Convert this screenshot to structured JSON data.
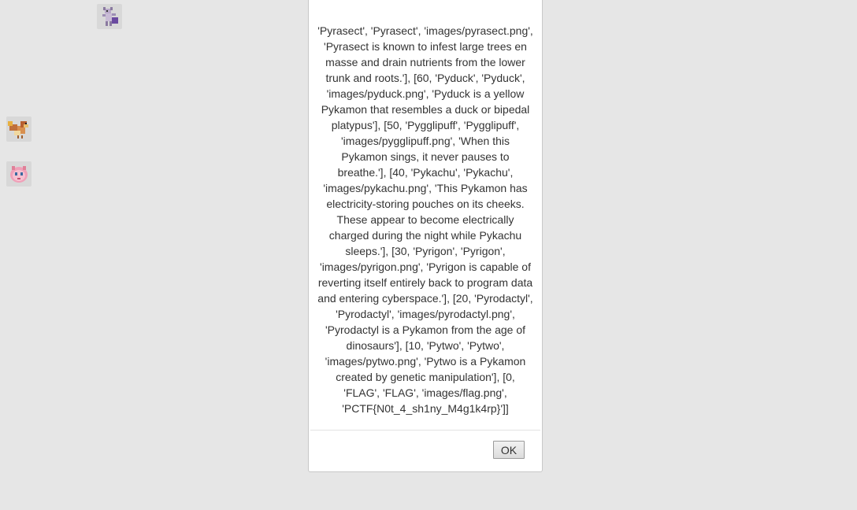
{
  "background": {
    "sprites": [
      {
        "name": "pytwo-sprite",
        "icon": "pytwo-icon"
      },
      {
        "name": "pidgeot-sprite",
        "icon": "bird-icon"
      },
      {
        "name": "jigglypuff-sprite",
        "icon": "pink-balloon-icon"
      }
    ]
  },
  "dialog": {
    "message": "'Pyrasect', 'Pyrasect', 'images/pyrasect.png', 'Pyrasect is known to infest large trees en masse and drain nutrients from the lower trunk and roots.'], [60, 'Pyduck', 'Pyduck', 'images/pyduck.png', 'Pyduck is a yellow Pykamon that resembles a duck or bipedal platypus'], [50, 'Pygglipuff', 'Pygglipuff', 'images/pygglipuff.png', 'When this Pykamon sings, it never pauses to breathe.'], [40, 'Pykachu', 'Pykachu', 'images/pykachu.png', 'This Pykamon has electricity-storing pouches on its cheeks. These appear to become electrically charged during the night while Pykachu sleeps.'], [30, 'Pyrigon', 'Pyrigon', 'images/pyrigon.png', 'Pyrigon is capable of reverting itself entirely back to program data and entering cyberspace.'], [20, 'Pyrodactyl', 'Pyrodactyl', 'images/pyrodactyl.png', 'Pyrodactyl is a Pykamon from the age of dinosaurs'], [10, 'Pytwo', 'Pytwo', 'images/pytwo.png', 'Pytwo is a Pykamon created by genetic manipulation'], [0, 'FLAG', 'FLAG', 'images/flag.png', 'PCTF{N0t_4_sh1ny_M4g1k4rp}']]",
    "ok_label": "OK"
  },
  "colors": {
    "page_background": "#e6e6e6",
    "dialog_background": "#ffffff",
    "text": "#333333"
  }
}
